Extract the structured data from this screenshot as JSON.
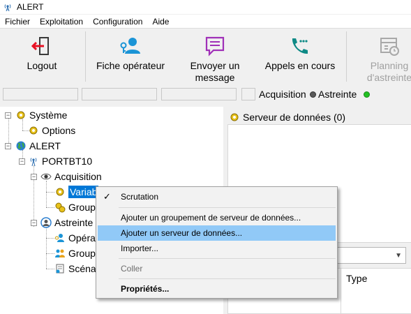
{
  "window": {
    "title": "ALERT"
  },
  "menu": [
    "Fichier",
    "Exploitation",
    "Configuration",
    "Aide"
  ],
  "toolbar": {
    "logout": "Logout",
    "fiche": "Fiche opérateur",
    "message_l1": "Envoyer un",
    "message_l2": "message",
    "appels": "Appels en cours",
    "planning_l1": "Planning",
    "planning_l2": "d'astreinte"
  },
  "status": {
    "acquisition": "Acquisition",
    "astreinte": "Astreinte",
    "acquisition_color": "#5a5a5a",
    "astreinte_color": "#22c022"
  },
  "tree": {
    "systeme": "Système",
    "options": "Options",
    "alert": "ALERT",
    "portbt": "PORTBT10",
    "acquisition": "Acquisition",
    "variables": "Variab",
    "groupes": "Group",
    "astreinte": "Astreinte",
    "operateurs": "Opéra",
    "groupes2": "Group",
    "scenarios": "Scéna"
  },
  "right": {
    "header": "Serveur de données (0)",
    "col_type": "Type"
  },
  "context_menu": {
    "items": [
      "Scrutation",
      "Ajouter un groupement de serveur de données...",
      "Ajouter un serveur de données...",
      "Importer...",
      "Coller",
      "Propriétés..."
    ]
  }
}
